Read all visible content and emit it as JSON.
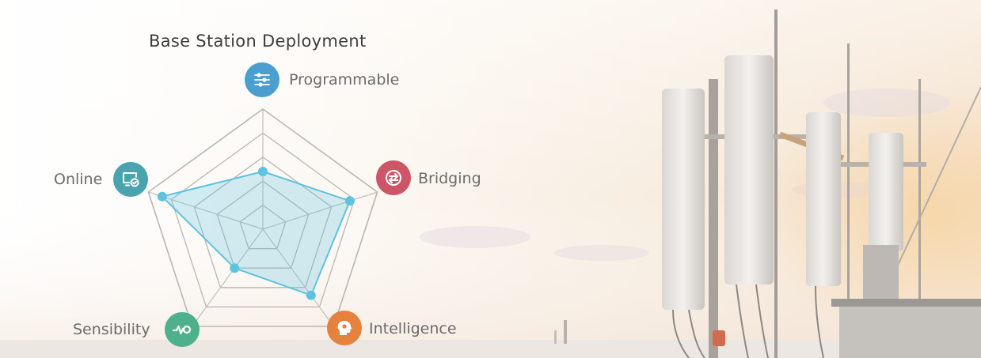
{
  "chart_data": {
    "type": "radar",
    "title": "Base Station Deployment",
    "axes": [
      "Programmable",
      "Bridging",
      "Intelligence",
      "Sensibility",
      "Online"
    ],
    "rings": 5,
    "rmax": 5,
    "series": [
      {
        "values": [
          2.4,
          3.8,
          3.4,
          2.0,
          4.4
        ]
      }
    ],
    "series_color": "#5ec3df"
  },
  "axis_icons": [
    {
      "axis": "Programmable",
      "icon": "circuit-nodes-icon",
      "color": "#4a9ed0"
    },
    {
      "axis": "Bridging",
      "icon": "swap-arrows-icon",
      "color": "#cc5566"
    },
    {
      "axis": "Intelligence",
      "icon": "head-brain-icon",
      "color": "#e4823e"
    },
    {
      "axis": "Sensibility",
      "icon": "pulse-wave-icon",
      "color": "#4eb08d"
    },
    {
      "axis": "Online",
      "icon": "monitor-check-icon",
      "color": "#4aa4b0"
    }
  ]
}
